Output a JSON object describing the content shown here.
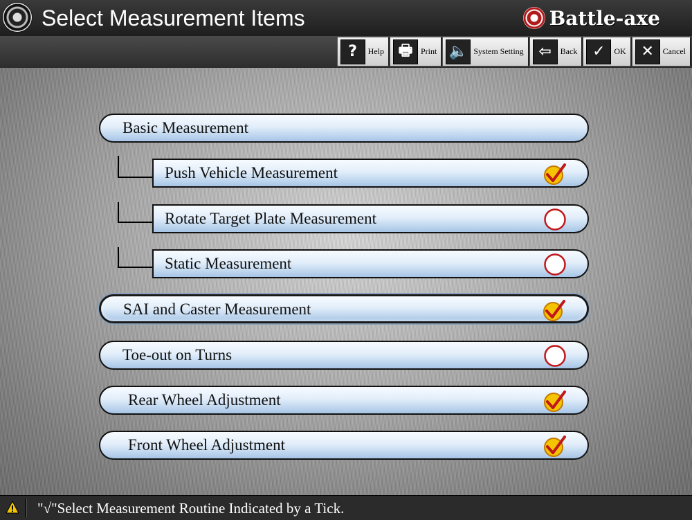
{
  "title": "Select Measurement Items",
  "brand": "Battle-axe",
  "toolbar": [
    {
      "name": "help-button",
      "icon": "help-icon",
      "glyph": "?",
      "label": "Help"
    },
    {
      "name": "print-button",
      "icon": "printer-icon",
      "glyph": "🖶",
      "label": "Print"
    },
    {
      "name": "system-setting-button",
      "icon": "speaker-icon",
      "glyph": "🔈",
      "label": "System Setting"
    },
    {
      "name": "back-button",
      "icon": "back-arrow-icon",
      "glyph": "⇦",
      "label": "Back"
    },
    {
      "name": "ok-button",
      "icon": "checkmark-icon",
      "glyph": "✓",
      "label": "OK"
    },
    {
      "name": "cancel-button",
      "icon": "close-icon",
      "glyph": "✕",
      "label": "Cancel"
    }
  ],
  "items": [
    {
      "label": "Basic Measurement",
      "checked": null
    },
    {
      "label": "Push Vehicle Measurement",
      "checked": true
    },
    {
      "label": "Rotate Target Plate Measurement",
      "checked": false
    },
    {
      "label": "Static Measurement",
      "checked": false
    },
    {
      "label": "SAI and Caster Measurement",
      "checked": true
    },
    {
      "label": "Toe-out on Turns",
      "checked": false
    },
    {
      "label": "Rear Wheel Adjustment",
      "checked": true
    },
    {
      "label": "Front Wheel Adjustment",
      "checked": true
    }
  ],
  "status": "\"√\"Select Measurement Routine Indicated by a Tick.",
  "colors": {
    "pill_top": "#f7fbff",
    "pill_bottom": "#a7c5e6",
    "tick": "#e8a000",
    "ring": "#c0181a"
  }
}
